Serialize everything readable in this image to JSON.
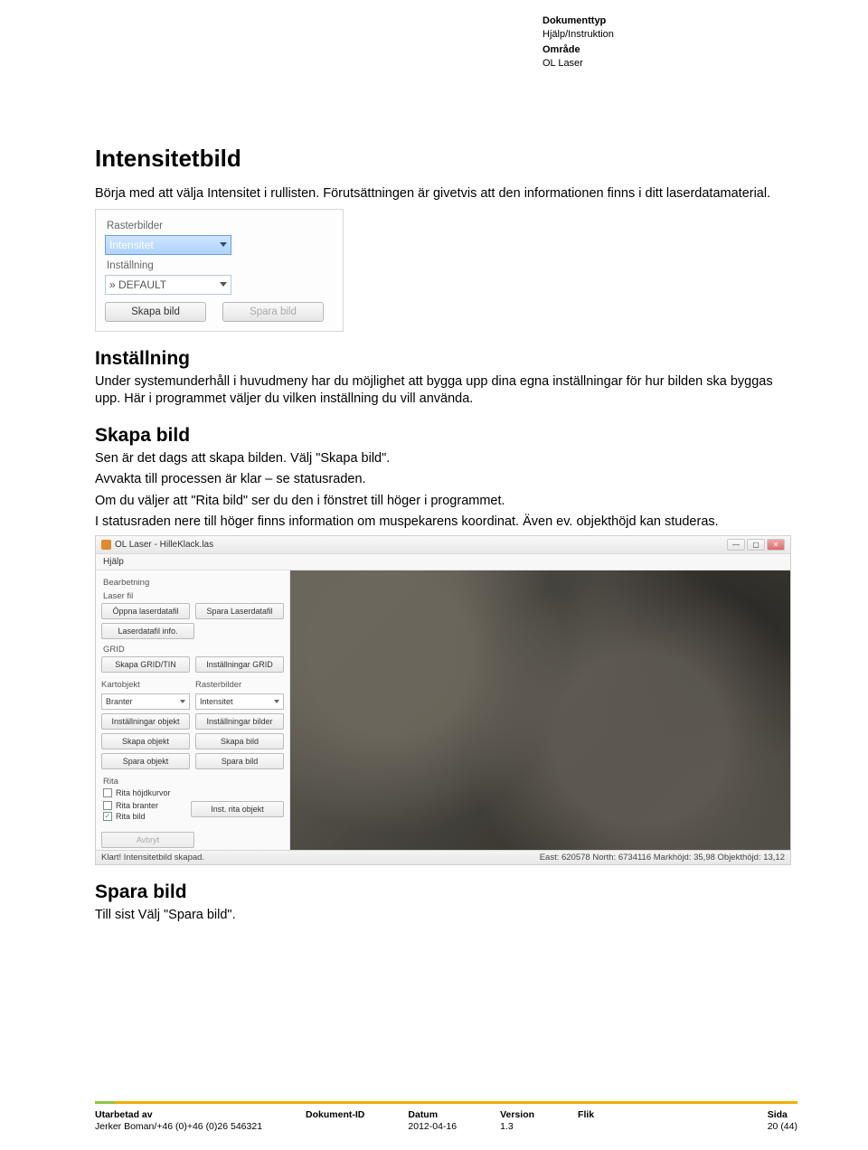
{
  "header": {
    "doctype_label": "Dokumenttyp",
    "doctype_value": "Hjälp/Instruktion",
    "area_label": "Område",
    "area_value": "OL Laser"
  },
  "h1": "Intensitetbild",
  "intro1": "Börja med att välja Intensitet i rullisten. Förutsättningen är givetvis att den informationen finns i ditt laserdatamaterial.",
  "ss1": {
    "rasterbilder": "Rasterbilder",
    "intensitet": "Intensitet",
    "installning": "Inställning",
    "default": "» DEFAULT",
    "skapa": "Skapa bild",
    "spara": "Spara bild"
  },
  "sec_installning": "Inställning",
  "p_installning": "Under systemunderhåll i huvudmeny har du möjlighet att bygga upp dina egna inställningar för hur bilden ska byggas upp. Här i programmet väljer du vilken inställning du vill använda.",
  "sec_skapa": "Skapa bild",
  "p_skapa1": "Sen är det dags att skapa bilden. Välj \"Skapa bild\".",
  "p_skapa2": "Avvakta till processen är klar – se statusraden.",
  "p_skapa3": "Om du väljer att \"Rita bild\" ser du den i fönstret till höger i programmet.",
  "p_skapa4": "I statusraden nere till höger finns information om muspekarens koordinat. Även ev. objekthöjd kan studeras.",
  "ss2": {
    "title": "OL Laser - HilleKlack.las",
    "menu": "Hjälp",
    "bearbetning": "Bearbetning",
    "laserfil": "Laser fil",
    "oppna": "Öppna laserdatafil",
    "sparalaser": "Spara Laserdatafil",
    "laserinfo": "Laserdatafil info.",
    "grid": "GRID",
    "skapagrid": "Skapa GRID/TIN",
    "instgrid": "Inställningar GRID",
    "kartobjekt": "Kartobjekt",
    "rasterbilder": "Rasterbilder",
    "branter": "Branter",
    "intensitet": "Intensitet",
    "instobj": "Inställningar objekt",
    "instbild": "Inställningar bilder",
    "skapaobj": "Skapa objekt",
    "skapabild": "Skapa bild",
    "sparaobj": "Spara objekt",
    "sparabild": "Spara bild",
    "rita": "Rita",
    "ritahojd": "Rita höjdkurvor",
    "ritabranter": "Rita branter",
    "ritabild": "Rita bild",
    "instritaobj": "Inst. rita objekt",
    "avbryt": "Avbryt",
    "status_left": "Klart! Intensitetbild skapad.",
    "status_right": "East: 620578   North: 6734116   Markhöjd: 35,98   Objekthöjd: 13,12"
  },
  "sec_spara": "Spara bild",
  "p_spara": "Till sist Välj \"Spara bild\".",
  "footer": {
    "c1h": "Utarbetad av",
    "c1v": "Jerker Boman/+46 (0)+46 (0)26 546321",
    "c2h": "Dokument-ID",
    "c2v": "",
    "c3h": "Datum",
    "c3v": "2012-04-16",
    "c4h": "Version",
    "c4v": "1.3",
    "c5h": "Flik",
    "c5v": "",
    "c6h": "Sida",
    "c6v": "20 (44)"
  }
}
